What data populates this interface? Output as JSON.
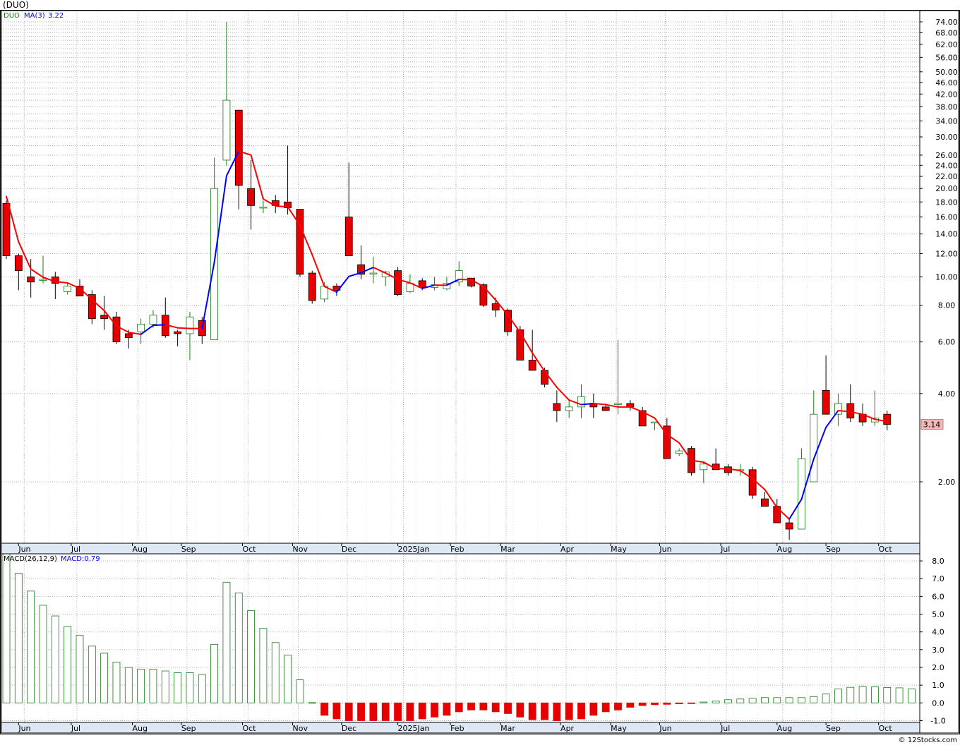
{
  "title": "(DUO)",
  "credit": "© 12Stocks.com",
  "colors": {
    "up": "#1a7a1a",
    "down": "#e60000",
    "ma_red": "#ff0000",
    "ma_blue": "#0000ff",
    "grid": "#b0b0b0",
    "axis_band": "#dde8f4"
  },
  "chart_data": [
    {
      "type": "candlestick",
      "scale": "log",
      "legend": {
        "symbol": "DUO",
        "ma_label": "MA(3)",
        "ma_value": "3.22"
      },
      "last_price_label": "3.14",
      "y_ticks": [
        "74.00",
        "68.00",
        "62.00",
        "56.00",
        "50.00",
        "46.00",
        "42.00",
        "38.00",
        "34.00",
        "30.00",
        "26.00",
        "24.00",
        "22.00",
        "20.00",
        "18.00",
        "16.00",
        "14.00",
        "12.00",
        "10.00",
        "8.00",
        "6.00",
        "4.00",
        "2.00"
      ],
      "x_labels": [
        "Jun",
        "Jul",
        "Aug",
        "Sep",
        "Oct",
        "Nov",
        "Dec",
        "2025Jan",
        "Feb",
        "Mar",
        "Apr",
        "May",
        "Jun",
        "Jul",
        "Aug",
        "Sep",
        "Oct"
      ],
      "candles": [
        {
          "o": 17.8,
          "h": 18.2,
          "l": 11.5,
          "c": 11.8
        },
        {
          "o": 11.8,
          "h": 12.0,
          "l": 9.0,
          "c": 10.5
        },
        {
          "o": 10.0,
          "h": 11.5,
          "l": 8.5,
          "c": 9.6
        },
        {
          "o": 9.8,
          "h": 11.8,
          "l": 9.5,
          "c": 9.8
        },
        {
          "o": 10.0,
          "h": 10.4,
          "l": 8.4,
          "c": 9.5
        },
        {
          "o": 8.9,
          "h": 9.6,
          "l": 8.7,
          "c": 9.3
        },
        {
          "o": 9.3,
          "h": 9.8,
          "l": 8.6,
          "c": 8.6
        },
        {
          "o": 8.7,
          "h": 9.0,
          "l": 6.9,
          "c": 7.2
        },
        {
          "o": 7.4,
          "h": 8.6,
          "l": 6.6,
          "c": 7.2
        },
        {
          "o": 7.3,
          "h": 7.6,
          "l": 5.9,
          "c": 6.0
        },
        {
          "o": 6.4,
          "h": 6.6,
          "l": 5.7,
          "c": 6.2
        },
        {
          "o": 6.5,
          "h": 7.2,
          "l": 5.9,
          "c": 6.9
        },
        {
          "o": 6.9,
          "h": 7.7,
          "l": 6.7,
          "c": 7.4
        },
        {
          "o": 7.4,
          "h": 8.5,
          "l": 6.2,
          "c": 6.3
        },
        {
          "o": 6.5,
          "h": 6.6,
          "l": 5.8,
          "c": 6.4
        },
        {
          "o": 6.4,
          "h": 7.6,
          "l": 5.2,
          "c": 7.3
        },
        {
          "o": 7.1,
          "h": 7.3,
          "l": 5.9,
          "c": 6.3
        },
        {
          "o": 6.1,
          "h": 25.5,
          "l": 6.1,
          "c": 20.0
        },
        {
          "o": 25.0,
          "h": 74.0,
          "l": 24.0,
          "c": 40.0
        },
        {
          "o": 37.0,
          "h": 37.0,
          "l": 17.0,
          "c": 20.5
        },
        {
          "o": 20.0,
          "h": 25.0,
          "l": 14.5,
          "c": 17.5
        },
        {
          "o": 17.3,
          "h": 18.2,
          "l": 16.5,
          "c": 17.3
        },
        {
          "o": 18.2,
          "h": 19.0,
          "l": 16.5,
          "c": 17.5
        },
        {
          "o": 18.0,
          "h": 28.0,
          "l": 16.3,
          "c": 17.2
        },
        {
          "o": 17.0,
          "h": 17.0,
          "l": 10.0,
          "c": 10.2
        },
        {
          "o": 10.3,
          "h": 10.5,
          "l": 8.1,
          "c": 8.3
        },
        {
          "o": 8.4,
          "h": 9.6,
          "l": 8.2,
          "c": 9.3
        },
        {
          "o": 9.3,
          "h": 9.5,
          "l": 8.6,
          "c": 9.0
        },
        {
          "o": 16.0,
          "h": 24.5,
          "l": 11.8,
          "c": 11.8
        },
        {
          "o": 11.0,
          "h": 12.8,
          "l": 9.8,
          "c": 10.2
        },
        {
          "o": 10.3,
          "h": 11.7,
          "l": 9.5,
          "c": 10.3
        },
        {
          "o": 10.0,
          "h": 10.5,
          "l": 9.3,
          "c": 10.4
        },
        {
          "o": 10.5,
          "h": 10.8,
          "l": 8.6,
          "c": 8.7
        },
        {
          "o": 8.9,
          "h": 10.2,
          "l": 8.8,
          "c": 9.5
        },
        {
          "o": 9.7,
          "h": 9.9,
          "l": 9.0,
          "c": 9.2
        },
        {
          "o": 9.2,
          "h": 10.0,
          "l": 9.0,
          "c": 9.4
        },
        {
          "o": 9.1,
          "h": 10.0,
          "l": 9.0,
          "c": 9.5
        },
        {
          "o": 9.6,
          "h": 11.3,
          "l": 9.3,
          "c": 10.5
        },
        {
          "o": 9.9,
          "h": 9.9,
          "l": 9.2,
          "c": 9.3
        },
        {
          "o": 9.4,
          "h": 9.5,
          "l": 7.9,
          "c": 8.0
        },
        {
          "o": 8.1,
          "h": 8.5,
          "l": 7.3,
          "c": 7.7
        },
        {
          "o": 7.7,
          "h": 7.8,
          "l": 6.3,
          "c": 6.5
        },
        {
          "o": 6.6,
          "h": 6.8,
          "l": 5.2,
          "c": 5.2
        },
        {
          "o": 5.2,
          "h": 6.6,
          "l": 4.8,
          "c": 4.8
        },
        {
          "o": 4.8,
          "h": 4.9,
          "l": 4.2,
          "c": 4.3
        },
        {
          "o": 3.7,
          "h": 4.1,
          "l": 3.2,
          "c": 3.5
        },
        {
          "o": 3.5,
          "h": 3.8,
          "l": 3.3,
          "c": 3.6
        },
        {
          "o": 3.6,
          "h": 4.3,
          "l": 3.3,
          "c": 3.9
        },
        {
          "o": 3.7,
          "h": 4.0,
          "l": 3.3,
          "c": 3.6
        },
        {
          "o": 3.6,
          "h": 3.7,
          "l": 3.5,
          "c": 3.5
        },
        {
          "o": 3.7,
          "h": 6.1,
          "l": 3.4,
          "c": 3.7
        },
        {
          "o": 3.7,
          "h": 3.8,
          "l": 3.5,
          "c": 3.6
        },
        {
          "o": 3.5,
          "h": 3.6,
          "l": 3.1,
          "c": 3.1
        },
        {
          "o": 3.2,
          "h": 3.2,
          "l": 3.0,
          "c": 3.2
        },
        {
          "o": 3.1,
          "h": 3.3,
          "l": 2.4,
          "c": 2.4
        },
        {
          "o": 2.5,
          "h": 2.6,
          "l": 2.45,
          "c": 2.55
        },
        {
          "o": 2.6,
          "h": 2.65,
          "l": 2.1,
          "c": 2.15
        },
        {
          "o": 2.2,
          "h": 2.35,
          "l": 1.98,
          "c": 2.3
        },
        {
          "o": 2.3,
          "h": 2.6,
          "l": 2.2,
          "c": 2.2
        },
        {
          "o": 2.25,
          "h": 2.3,
          "l": 2.1,
          "c": 2.15
        },
        {
          "o": 2.2,
          "h": 2.3,
          "l": 2.1,
          "c": 2.2
        },
        {
          "o": 2.2,
          "h": 2.25,
          "l": 1.75,
          "c": 1.8
        },
        {
          "o": 1.75,
          "h": 1.85,
          "l": 1.65,
          "c": 1.65
        },
        {
          "o": 1.65,
          "h": 1.75,
          "l": 1.45,
          "c": 1.45
        },
        {
          "o": 1.45,
          "h": 1.5,
          "l": 1.27,
          "c": 1.38
        },
        {
          "o": 1.38,
          "h": 2.6,
          "l": 1.38,
          "c": 2.4
        },
        {
          "o": 2.0,
          "h": 4.1,
          "l": 2.0,
          "c": 3.4
        },
        {
          "o": 4.1,
          "h": 5.4,
          "l": 3.4,
          "c": 3.4
        },
        {
          "o": 3.4,
          "h": 4.0,
          "l": 3.1,
          "c": 3.7
        },
        {
          "o": 3.7,
          "h": 4.3,
          "l": 3.2,
          "c": 3.3
        },
        {
          "o": 3.4,
          "h": 3.7,
          "l": 3.1,
          "c": 3.2
        },
        {
          "o": 3.2,
          "h": 4.1,
          "l": 3.1,
          "c": 3.3
        },
        {
          "o": 3.4,
          "h": 3.5,
          "l": 3.0,
          "c": 3.14
        }
      ],
      "ma_period": 3
    },
    {
      "type": "bar",
      "legend": {
        "name": "MACD(26,12,9)",
        "value_label": "MACD:0.79"
      },
      "y_ticks": [
        "8.0",
        "7.0",
        "6.0",
        "5.0",
        "4.0",
        "3.0",
        "2.0",
        "1.0",
        "0.0",
        "-1.0"
      ],
      "ylim": [
        -1.1,
        8.4
      ],
      "values": [
        8.4,
        7.3,
        6.3,
        5.5,
        4.9,
        4.3,
        3.8,
        3.2,
        2.8,
        2.3,
        2.0,
        1.9,
        1.9,
        1.8,
        1.7,
        1.7,
        1.6,
        3.3,
        6.8,
        6.2,
        5.2,
        4.2,
        3.4,
        2.7,
        1.3,
        0.02,
        -0.7,
        -0.9,
        -1.0,
        -1.0,
        -1.0,
        -1.0,
        -1.0,
        -1.0,
        -0.9,
        -0.8,
        -0.7,
        -0.5,
        -0.4,
        -0.4,
        -0.5,
        -0.6,
        -0.8,
        -0.95,
        -0.95,
        -1.0,
        -0.95,
        -0.9,
        -0.7,
        -0.5,
        -0.4,
        -0.25,
        -0.15,
        -0.1,
        -0.08,
        -0.05,
        -0.03,
        0.05,
        0.1,
        0.18,
        0.22,
        0.26,
        0.3,
        0.3,
        0.3,
        0.3,
        0.36,
        0.5,
        0.78,
        0.88,
        0.92,
        0.9,
        0.87,
        0.85,
        0.79
      ]
    }
  ]
}
